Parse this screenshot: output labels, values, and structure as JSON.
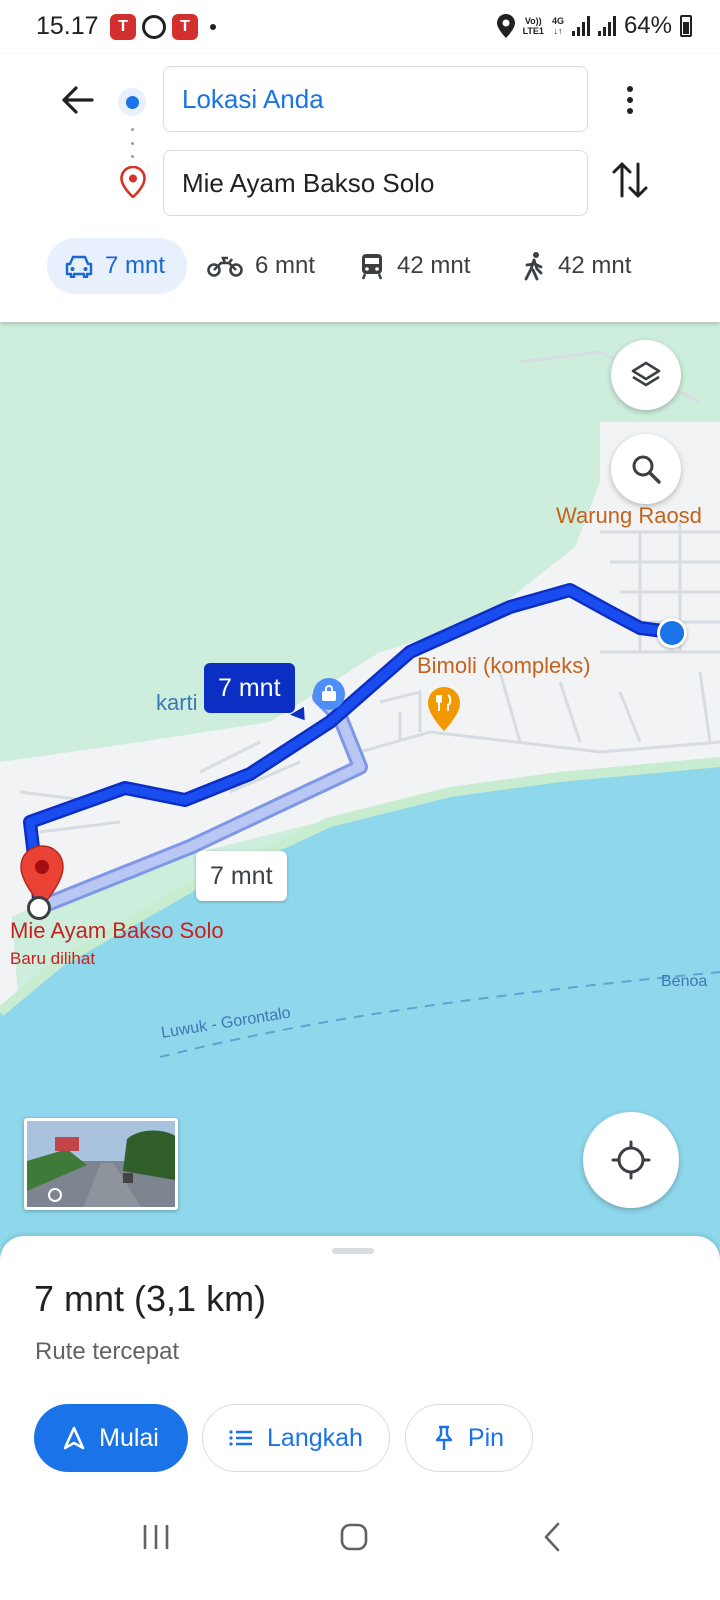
{
  "status_bar": {
    "time": "15.17",
    "network_line1": "Vo))",
    "network_line2": "LTE1",
    "network_type": "4G",
    "battery": "64%",
    "notification_icons": [
      "notification-app-icon",
      "opera-icon",
      "notification-app-icon"
    ]
  },
  "directions": {
    "origin": "Lokasi Anda",
    "destination": "Mie Ayam Bakso Solo"
  },
  "modes": [
    {
      "name": "car",
      "label": "7 mnt",
      "active": true
    },
    {
      "name": "motorcycle",
      "label": "6 mnt",
      "active": false
    },
    {
      "name": "transit",
      "label": "42 mnt",
      "active": false
    },
    {
      "name": "walk",
      "label": "42 mnt",
      "active": false
    }
  ],
  "map": {
    "labels": {
      "warung": "Warung Raosd",
      "bimoli": "Bimoli (kompleks)",
      "karti": "karti",
      "destination_name": "Mie Ayam Bakso Solo",
      "destination_note": "Baru dilihat",
      "ferry_route": "Luwuk - Gorontalo",
      "benoa": "Benoa"
    },
    "primary_route_time": "7 mnt",
    "alternate_route_time": "7 mnt",
    "colors": {
      "land": "#f1f3f4",
      "green": "#cdeedd",
      "water": "#8fd8ec",
      "route_primary": "#1a4df0",
      "route_alt": "#a7b9f4"
    }
  },
  "route": {
    "summary": "7 mnt (3,1 km)",
    "description": "Rute tercepat"
  },
  "actions": {
    "start": "Mulai",
    "steps": "Langkah",
    "pin": "Pin"
  }
}
